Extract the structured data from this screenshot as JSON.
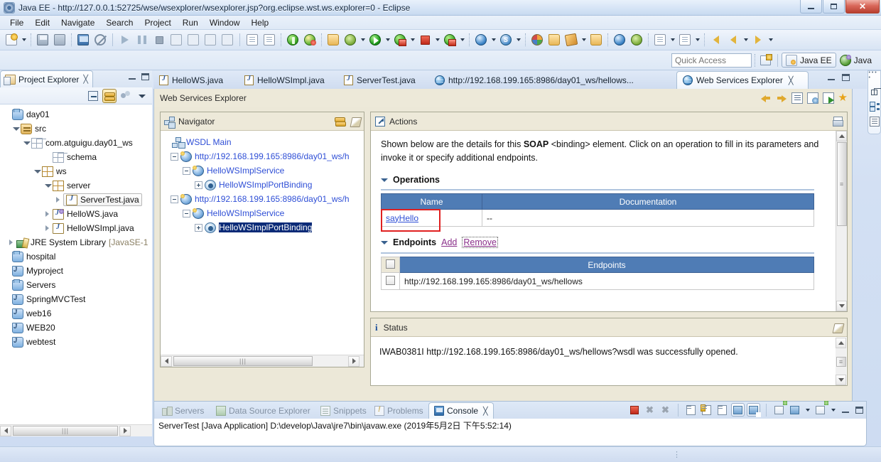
{
  "window": {
    "title": "Java EE - http://127.0.0.1:52725/wse/wsexplorer/wsexplorer.jsp?org.eclipse.wst.ws.explorer=0 - Eclipse",
    "icon": "eclipse-icon",
    "minimize_label": "—",
    "maximize_label": "□",
    "close_label": "✕"
  },
  "menu": {
    "items": [
      {
        "label": "File"
      },
      {
        "label": "Edit"
      },
      {
        "label": "Navigate"
      },
      {
        "label": "Search"
      },
      {
        "label": "Project"
      },
      {
        "label": "Run"
      },
      {
        "label": "Window"
      },
      {
        "label": "Help"
      }
    ]
  },
  "quick_access": {
    "placeholder": "Quick Access",
    "value": "",
    "open_perspective_title": "Open Perspective",
    "perspectives": [
      {
        "label": "Java EE",
        "active": true
      },
      {
        "label": "Java",
        "active": false
      }
    ]
  },
  "project_explorer": {
    "tab_label": "Project Explorer",
    "close_label": "╳",
    "tools": [
      "collapse-all",
      "link-with-editor",
      "view-filters",
      "view-menu"
    ],
    "tree": [
      {
        "label": "day01",
        "indent": 0,
        "twisty": "none",
        "icon": "project-closed",
        "selected": false
      },
      {
        "label": "src",
        "indent": 1,
        "twisty": "down",
        "icon": "source-folder",
        "selected": false
      },
      {
        "label": "com.atguigu.day01_ws",
        "indent": 2,
        "twisty": "down",
        "icon": "package-empty",
        "selected": false
      },
      {
        "label": "schema",
        "indent": 3,
        "twisty": "none",
        "icon": "package-empty",
        "selected": false
      },
      {
        "label": "ws",
        "indent": 3,
        "twisty": "down",
        "icon": "package",
        "selected": false
      },
      {
        "label": "server",
        "indent": 4,
        "twisty": "down",
        "icon": "package",
        "selected": false
      },
      {
        "label": "ServerTest.java",
        "indent": 5,
        "twisty": "right",
        "icon": "java-class",
        "selected": true
      },
      {
        "label": "HelloWS.java",
        "indent": 4,
        "twisty": "right",
        "icon": "java-interface",
        "selected": false
      },
      {
        "label": "HelloWSImpl.java",
        "indent": 4,
        "twisty": "right",
        "icon": "java-class",
        "selected": false
      },
      {
        "label": "JRE System Library",
        "suffix": "[JavaSE-1",
        "indent": 1,
        "twisty": "right",
        "icon": "jre-library",
        "selected": false
      },
      {
        "label": "hospital",
        "indent": 0,
        "twisty": "none",
        "icon": "project-closed",
        "selected": false
      },
      {
        "label": "Myproject",
        "indent": 0,
        "twisty": "none",
        "icon": "project-java",
        "selected": false
      },
      {
        "label": "Servers",
        "indent": 0,
        "twisty": "none",
        "icon": "project-closed",
        "selected": false
      },
      {
        "label": "SpringMVCTest",
        "indent": 0,
        "twisty": "none",
        "icon": "project-java",
        "selected": false
      },
      {
        "label": "web16",
        "indent": 0,
        "twisty": "none",
        "icon": "project-java",
        "selected": false
      },
      {
        "label": "WEB20",
        "indent": 0,
        "twisty": "none",
        "icon": "project-java",
        "selected": false
      },
      {
        "label": "webtest",
        "indent": 0,
        "twisty": "none",
        "icon": "project-java",
        "selected": false
      }
    ]
  },
  "editor_tabs": [
    {
      "label": "HelloWS.java",
      "icon": "java-file-icon",
      "active": false
    },
    {
      "label": "HelloWSImpl.java",
      "icon": "java-file-icon",
      "active": false
    },
    {
      "label": "ServerTest.java",
      "icon": "java-file-icon",
      "active": false
    },
    {
      "label": "http://192.168.199.165:8986/day01_ws/hellows...",
      "icon": "globe-icon",
      "active": false
    },
    {
      "label": "Web Services Explorer",
      "icon": "globe-icon",
      "active": true,
      "close_label": "╳"
    }
  ],
  "wse": {
    "header_title": "Web Services Explorer",
    "header_icons": [
      "back-icon",
      "forward-icon",
      "wsdl-page-icon",
      "wsdl-explorer-icon",
      "uddi-explorer-icon",
      "favorites-icon"
    ],
    "navigator": {
      "title": "Navigator",
      "tools": [
        "reset-icon",
        "clear-icon"
      ],
      "nodes": [
        {
          "label": "WSDL Main",
          "indent": 0,
          "expander": "none",
          "icon": "wsdl-main-icon",
          "style": "link"
        },
        {
          "label": "http://192.168.199.165:8986/day01_ws/h",
          "indent": 1,
          "expander": "minus",
          "icon": "wsdl-service-icon",
          "style": "link"
        },
        {
          "label": "HelloWSImplService",
          "indent": 2,
          "expander": "minus",
          "icon": "service-icon",
          "style": "link"
        },
        {
          "label": "HelloWSImplPortBinding",
          "indent": 3,
          "expander": "plus",
          "icon": "binding-icon",
          "style": "link"
        },
        {
          "label": "http://192.168.199.165:8986/day01_ws/h",
          "indent": 1,
          "expander": "minus",
          "icon": "wsdl-service-icon",
          "style": "link"
        },
        {
          "label": "HelloWSImplService",
          "indent": 2,
          "expander": "minus",
          "icon": "service-icon",
          "style": "link"
        },
        {
          "label": "HelloWSImplPortBinding",
          "indent": 3,
          "expander": "plus",
          "icon": "binding-icon",
          "style": "selected"
        }
      ]
    },
    "actions": {
      "title": "Actions",
      "print_icon": "print-icon",
      "description_part1": "Shown below are the details for this ",
      "description_bold": "SOAP",
      "description_part2": " <binding> element. Click on an operation to fill in its parameters and invoke it or specify additional endpoints.",
      "operations": {
        "section_title": "Operations",
        "columns": [
          "Name",
          "Documentation"
        ],
        "rows": [
          {
            "name": "sayHello",
            "documentation": "--",
            "highlighted": true
          }
        ]
      },
      "endpoints": {
        "section_title": "Endpoints",
        "add_label": "Add",
        "remove_label": "Remove",
        "column": "Endpoints",
        "rows": [
          {
            "url": "http://192.168.199.165:8986/day01_ws/hellows",
            "checked": false
          }
        ]
      }
    },
    "status": {
      "title": "Status",
      "info_icon": "info-icon",
      "message": "IWAB0381I http://192.168.199.165:8986/day01_ws/hellows?wsdl was successfully opened."
    }
  },
  "console": {
    "tabs": [
      {
        "label": "Servers",
        "icon": "servers-icon",
        "active": false
      },
      {
        "label": "Data Source Explorer",
        "icon": "data-source-icon",
        "active": false
      },
      {
        "label": "Snippets",
        "icon": "snippets-icon",
        "active": false
      },
      {
        "label": "Problems",
        "icon": "problems-icon",
        "active": false
      },
      {
        "label": "Console",
        "icon": "console-icon",
        "active": true,
        "close_label": "╳"
      }
    ],
    "tools": [
      "terminate-icon",
      "remove-launch-icon",
      "remove-all-icon",
      "clear-console-icon",
      "scroll-lock-icon",
      "pin-console-icon",
      "display-console-icon",
      "display-error-console-icon",
      "open-console-icon",
      "console-menu-icon"
    ],
    "line1": "ServerTest [Java Application] D:\\develop\\Java\\jre7\\bin\\javaw.exe (2019年5月2日 下午5:52:14)"
  },
  "colors": {
    "accent_blue": "#4f7cb5",
    "link_blue": "#2f4fd6",
    "selection_navy": "#0a2a77",
    "highlight_red": "#e02020",
    "link_magenta": "#8a2f8a",
    "panel_beige": "#ede9d9"
  }
}
